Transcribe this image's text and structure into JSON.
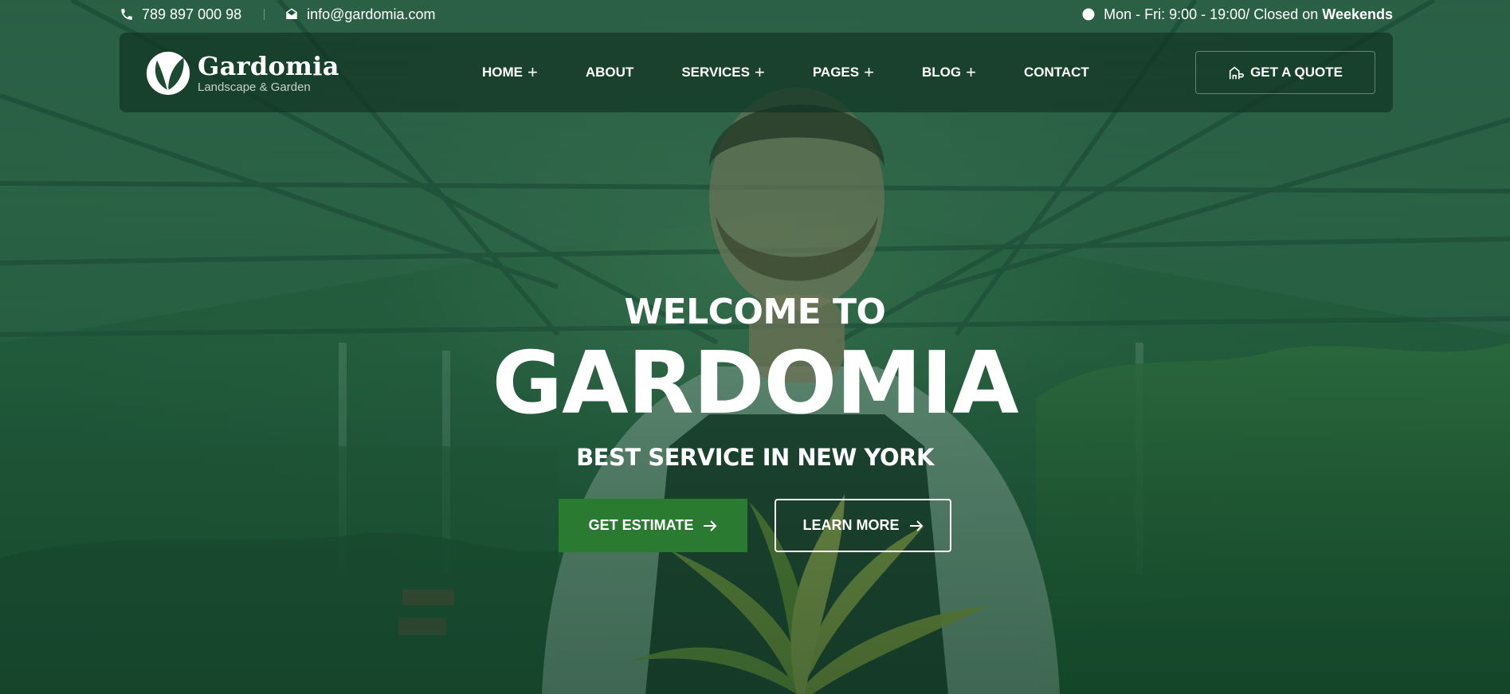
{
  "topbar": {
    "phone": "789 897 000 98",
    "email": "info@gardomia.com",
    "hours_prefix": "Mon - Fri: 9:00 - 19:00/ Closed on",
    "hours_emphasis": "Weekends",
    "icons": [
      "phone-icon",
      "envelope-icon",
      "clock-icon"
    ]
  },
  "header": {
    "logo_name": "Gardomia",
    "logo_tagline": "Landscape & Garden",
    "nav": [
      {
        "label": "Home",
        "has_submenu": true
      },
      {
        "label": "About",
        "has_submenu": false
      },
      {
        "label": "Services",
        "has_submenu": true
      },
      {
        "label": "Pages",
        "has_submenu": true
      },
      {
        "label": "Blog",
        "has_submenu": true
      },
      {
        "label": "Contact",
        "has_submenu": false
      }
    ],
    "quote_button": "GET A QUOTE"
  },
  "hero": {
    "welcome": "WELCOME TO",
    "brand": "GARDOMIA",
    "tagline": "BEST SERVICE IN NEW YORK",
    "primary_button": "Get Estimate",
    "secondary_button": "Learn More"
  },
  "colors": {
    "accent_green": "#2b7a32",
    "header_bg": "#12342487",
    "overlay": "#0c462a"
  }
}
